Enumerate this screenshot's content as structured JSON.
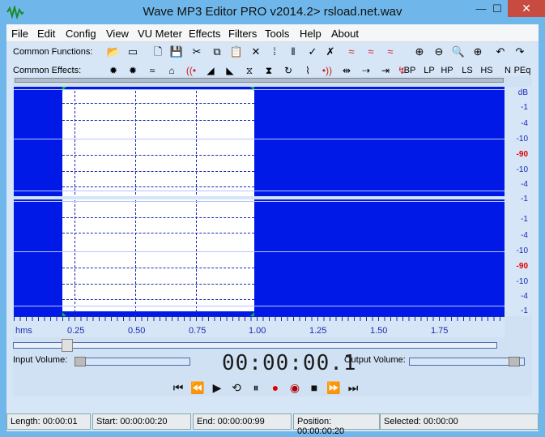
{
  "window": {
    "title": "Wave MP3 Editor PRO v2014.2> rsload.net.wav",
    "min": "—",
    "max": "☐",
    "close": "✕"
  },
  "menu": [
    "File",
    "Edit",
    "Config",
    "View",
    "VU Meter",
    "Effects",
    "Filters",
    "Tools",
    "Help",
    "About"
  ],
  "toolbar": {
    "functions_label": "Common Functions:",
    "effects_label": "Common Effects:",
    "functions": [
      {
        "icon": "open-folder-icon",
        "glyph": "📂"
      },
      {
        "icon": "blank-icon",
        "glyph": "▭"
      },
      {
        "icon": "new-file-icon",
        "glyph": "🗋"
      },
      {
        "icon": "save-icon",
        "glyph": "💾"
      },
      {
        "icon": "cut-icon",
        "glyph": "✂"
      },
      {
        "icon": "copy-icon",
        "glyph": "⧉"
      },
      {
        "icon": "paste-icon",
        "glyph": "📋"
      },
      {
        "icon": "trim-icon",
        "glyph": "✕"
      },
      {
        "icon": "select-icon",
        "glyph": "⁞"
      },
      {
        "icon": "marker-icon",
        "glyph": "‖"
      },
      {
        "icon": "check-icon",
        "glyph": "✓"
      },
      {
        "icon": "uncheck-icon",
        "glyph": "✗"
      },
      {
        "icon": "wave1-icon",
        "glyph": "≈"
      },
      {
        "icon": "wave2-icon",
        "glyph": "≈"
      },
      {
        "icon": "wave3-icon",
        "glyph": "≈"
      },
      {
        "icon": "zoom-in-icon",
        "glyph": "⊕"
      },
      {
        "icon": "zoom-out-icon",
        "glyph": "⊖"
      },
      {
        "icon": "zoom-icon",
        "glyph": "🔍"
      },
      {
        "icon": "zoom-full-icon",
        "glyph": "⊕"
      },
      {
        "icon": "undo-icon",
        "glyph": "↶"
      },
      {
        "icon": "redo-icon",
        "glyph": "↷"
      }
    ],
    "effects": [
      {
        "icon": "amplify-icon",
        "glyph": "✹"
      },
      {
        "icon": "normalize-icon",
        "glyph": "✹"
      },
      {
        "icon": "echo-icon",
        "glyph": "≈"
      },
      {
        "icon": "hall-icon",
        "glyph": "⌂"
      },
      {
        "icon": "reverb-icon",
        "glyph": "((•"
      },
      {
        "icon": "fade-in-icon",
        "glyph": "◢"
      },
      {
        "icon": "fade-out-icon",
        "glyph": "◣"
      },
      {
        "icon": "compress-icon",
        "glyph": "⧖"
      },
      {
        "icon": "expand-icon",
        "glyph": "⧗"
      },
      {
        "icon": "loop-icon",
        "glyph": "↻"
      },
      {
        "icon": "spectrum-icon",
        "glyph": "⌇"
      },
      {
        "icon": "vibrato-icon",
        "glyph": "•))"
      },
      {
        "icon": "reverse-icon",
        "glyph": "⇹"
      },
      {
        "icon": "shift-icon",
        "glyph": "⇢"
      },
      {
        "icon": "stretch-icon",
        "glyph": "⇥"
      },
      {
        "icon": "pitch-icon",
        "glyph": "↯"
      }
    ],
    "filters": [
      "BP",
      "LP",
      "HP",
      "LS",
      "HS",
      "N",
      "PEq"
    ]
  },
  "scale": {
    "unit": "dB",
    "labels": [
      "-1",
      "-4",
      "-10",
      "-90",
      "-10",
      "-4",
      "-1"
    ],
    "red_label": "-90"
  },
  "ruler": {
    "unit": "hms",
    "ticks": [
      "0.25",
      "0.50",
      "0.75",
      "1.00",
      "1.25",
      "1.50",
      "1.75"
    ]
  },
  "volume": {
    "input_label": "Input Volume:",
    "output_label": "Output Volume:",
    "input_level": 0,
    "output_level": 0.95
  },
  "time_display": "00:00:00.1",
  "transport": [
    {
      "icon": "skip-start-icon",
      "glyph": "⏮"
    },
    {
      "icon": "rewind-icon",
      "glyph": "⏪"
    },
    {
      "icon": "play-icon",
      "glyph": "▶"
    },
    {
      "icon": "loop-play-icon",
      "glyph": "⟲"
    },
    {
      "icon": "pause-icon",
      "glyph": "⏸"
    },
    {
      "icon": "record-icon",
      "glyph": "●",
      "color": "#e00000"
    },
    {
      "icon": "record-stop-icon",
      "glyph": "◉",
      "color": "#b00000"
    },
    {
      "icon": "stop-icon",
      "glyph": "■"
    },
    {
      "icon": "forward-icon",
      "glyph": "⏩"
    },
    {
      "icon": "skip-end-icon",
      "glyph": "⏭"
    }
  ],
  "status": {
    "length": "Length: 00:00:01",
    "start": "Start: 00:00:00:20",
    "end": "End: 00:00:00:99",
    "position": "Position: 00:00:00:20",
    "selected": "Selected: 00:00:00"
  },
  "colors": {
    "wave_bg": "#0019e6",
    "selection": "#ffffff",
    "marker": "#00c040",
    "accent": "#e00000"
  }
}
